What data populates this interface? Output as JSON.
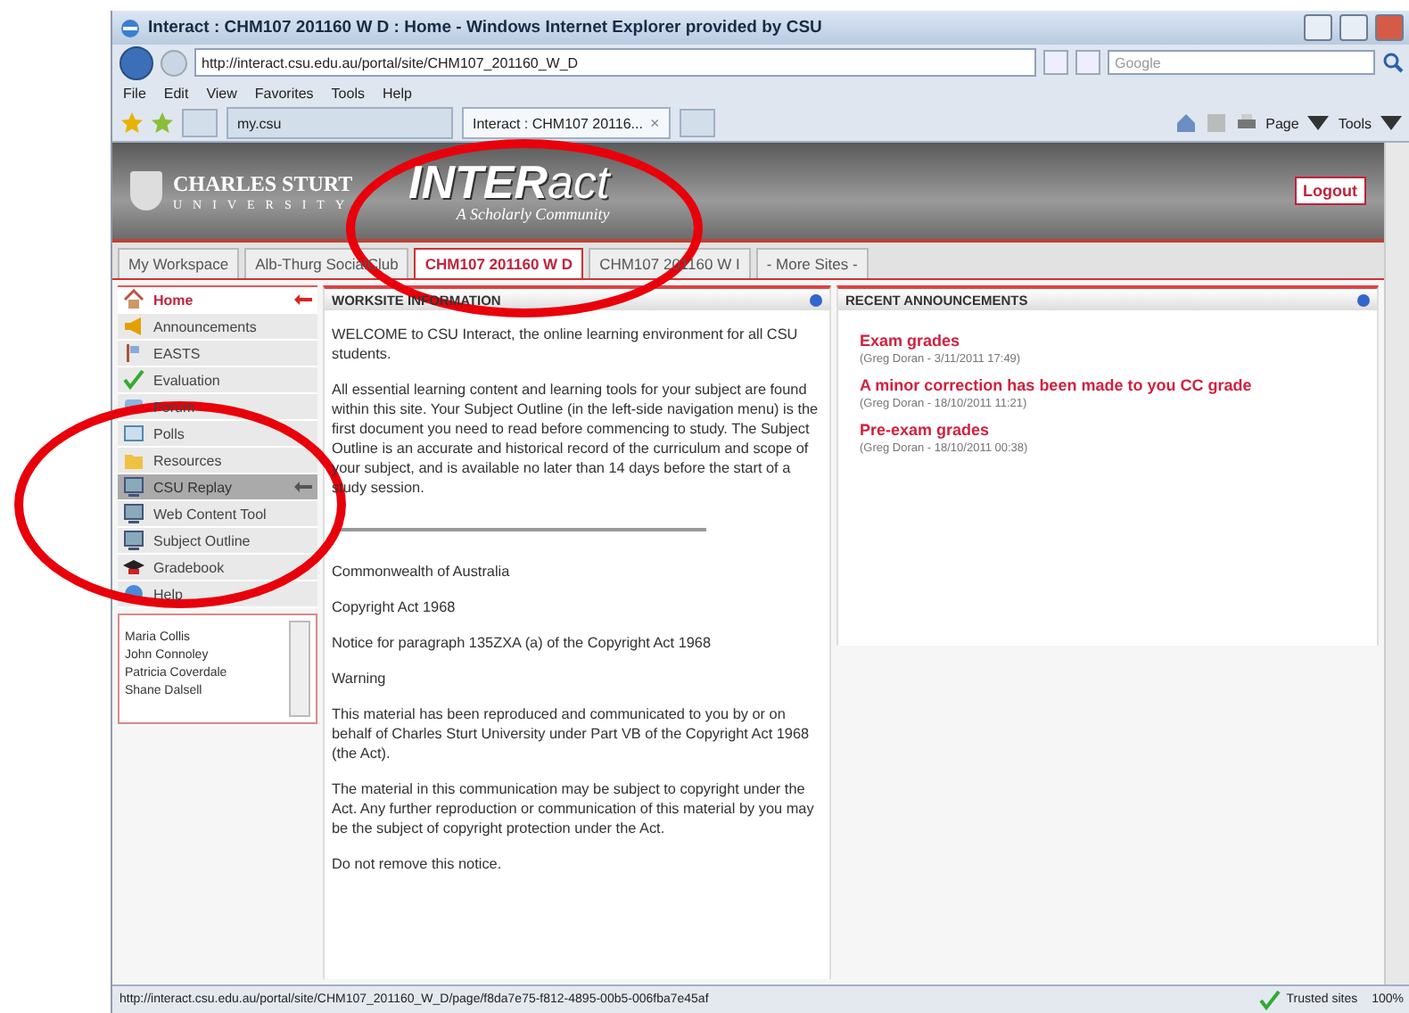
{
  "window": {
    "title": "Interact : CHM107 201160 W D : Home - Windows Internet Explorer provided by CSU"
  },
  "nav": {
    "address": "http://interact.csu.edu.au/portal/site/CHM107_201160_W_D",
    "search_placeholder": "Google"
  },
  "menu": [
    "File",
    "Edit",
    "View",
    "Favorites",
    "Tools",
    "Help"
  ],
  "browser_tabs": [
    {
      "label": "my.csu",
      "selected": false
    },
    {
      "label": "Interact : CHM107 20116...",
      "selected": true
    }
  ],
  "browser_tab_close": "×",
  "command_bar": [
    "Page",
    "Tools"
  ],
  "site": {
    "logo_line1": "CHARLES STURT",
    "logo_line2": "UNIVERSITY",
    "app_logo_bold": "INTER",
    "app_logo_light": "act",
    "tagline": "A Scholarly Community",
    "logout": "Logout"
  },
  "site_tabs": [
    {
      "label": "My Workspace",
      "selected": false
    },
    {
      "label": "Alb-Thurg SocialClub",
      "selected": false
    },
    {
      "label": "CHM107 201160 W D",
      "selected": true
    },
    {
      "label": "CHM107 201160 W I",
      "selected": false
    },
    {
      "label": "- More Sites -",
      "selected": false
    }
  ],
  "sidebar": {
    "items": [
      {
        "label": "Home",
        "kind": "home",
        "selected": true,
        "highlighted": false
      },
      {
        "label": "Announcements",
        "kind": "megaphone",
        "selected": false,
        "highlighted": false
      },
      {
        "label": "EASTS",
        "kind": "flag",
        "selected": false,
        "highlighted": false
      },
      {
        "label": "Evaluation",
        "kind": "tick",
        "selected": false,
        "highlighted": false
      },
      {
        "label": "Forum",
        "kind": "chat",
        "selected": false,
        "highlighted": false
      },
      {
        "label": "Polls",
        "kind": "window",
        "selected": false,
        "highlighted": false
      },
      {
        "label": "Resources",
        "kind": "folder",
        "selected": false,
        "highlighted": false
      },
      {
        "label": "CSU Replay",
        "kind": "monitor",
        "selected": false,
        "highlighted": true
      },
      {
        "label": "Web Content Tool",
        "kind": "monitor",
        "selected": false,
        "highlighted": false
      },
      {
        "label": "Subject Outline",
        "kind": "monitor",
        "selected": false,
        "highlighted": false
      },
      {
        "label": "Gradebook",
        "kind": "cap",
        "selected": false,
        "highlighted": false
      },
      {
        "label": "Help",
        "kind": "help",
        "selected": false,
        "highlighted": false
      }
    ],
    "participants": [
      "Maria Collis",
      "John Connoley",
      "Patricia Coverdale",
      "Shane Dalsell"
    ]
  },
  "worksite": {
    "title": "WORKSITE INFORMATION",
    "blocks": [
      {
        "kind": "text",
        "text": "WELCOME to CSU Interact, the online learning environment for all CSU students."
      },
      {
        "kind": "text",
        "text": "All essential learning content and learning tools for your subject are found within this site. Your Subject Outline (in the left-side navigation menu) is the first document you need to read before commencing to study. The Subject Outline is an accurate and historical record of the curriculum and scope of your subject, and is available no later than 14 days before the start of a study session."
      },
      {
        "kind": "rule"
      },
      {
        "kind": "text",
        "text": "Commonwealth of Australia"
      },
      {
        "kind": "text",
        "text": "Copyright Act 1968"
      },
      {
        "kind": "text",
        "text": "Notice for paragraph 135ZXA (a) of the Copyright Act 1968"
      },
      {
        "kind": "text",
        "text": "Warning"
      },
      {
        "kind": "text",
        "text": "This material has been reproduced and communicated to you by or on behalf of Charles Sturt University under Part VB of the Copyright Act 1968 (the Act)."
      },
      {
        "kind": "text",
        "text": "The material in this communication may be subject to copyright under the Act. Any further reproduction or communication of this material by you may be the subject of copyright protection under the Act."
      },
      {
        "kind": "text",
        "text": "Do not remove this notice."
      }
    ]
  },
  "announcements": {
    "title": "RECENT ANNOUNCEMENTS",
    "items": [
      {
        "title": "Exam grades",
        "meta": "(Greg Doran - 3/11/2011 17:49)"
      },
      {
        "title": "A minor correction has been made to you CC grade",
        "meta": "(Greg Doran - 18/10/2011 11:21)"
      },
      {
        "title": "Pre-exam grades",
        "meta": "(Greg Doran - 18/10/2011 00:38)"
      }
    ]
  },
  "status_bar": {
    "url": "http://interact.csu.edu.au/portal/site/CHM107_201160_W_D/page/f8da7e75-f812-4895-00b5-006fba7e45af",
    "zone": "Trusted sites",
    "zoom": "100%"
  },
  "annotations": [
    {
      "kind": "ellipse"
    },
    {
      "kind": "ellipse"
    }
  ]
}
